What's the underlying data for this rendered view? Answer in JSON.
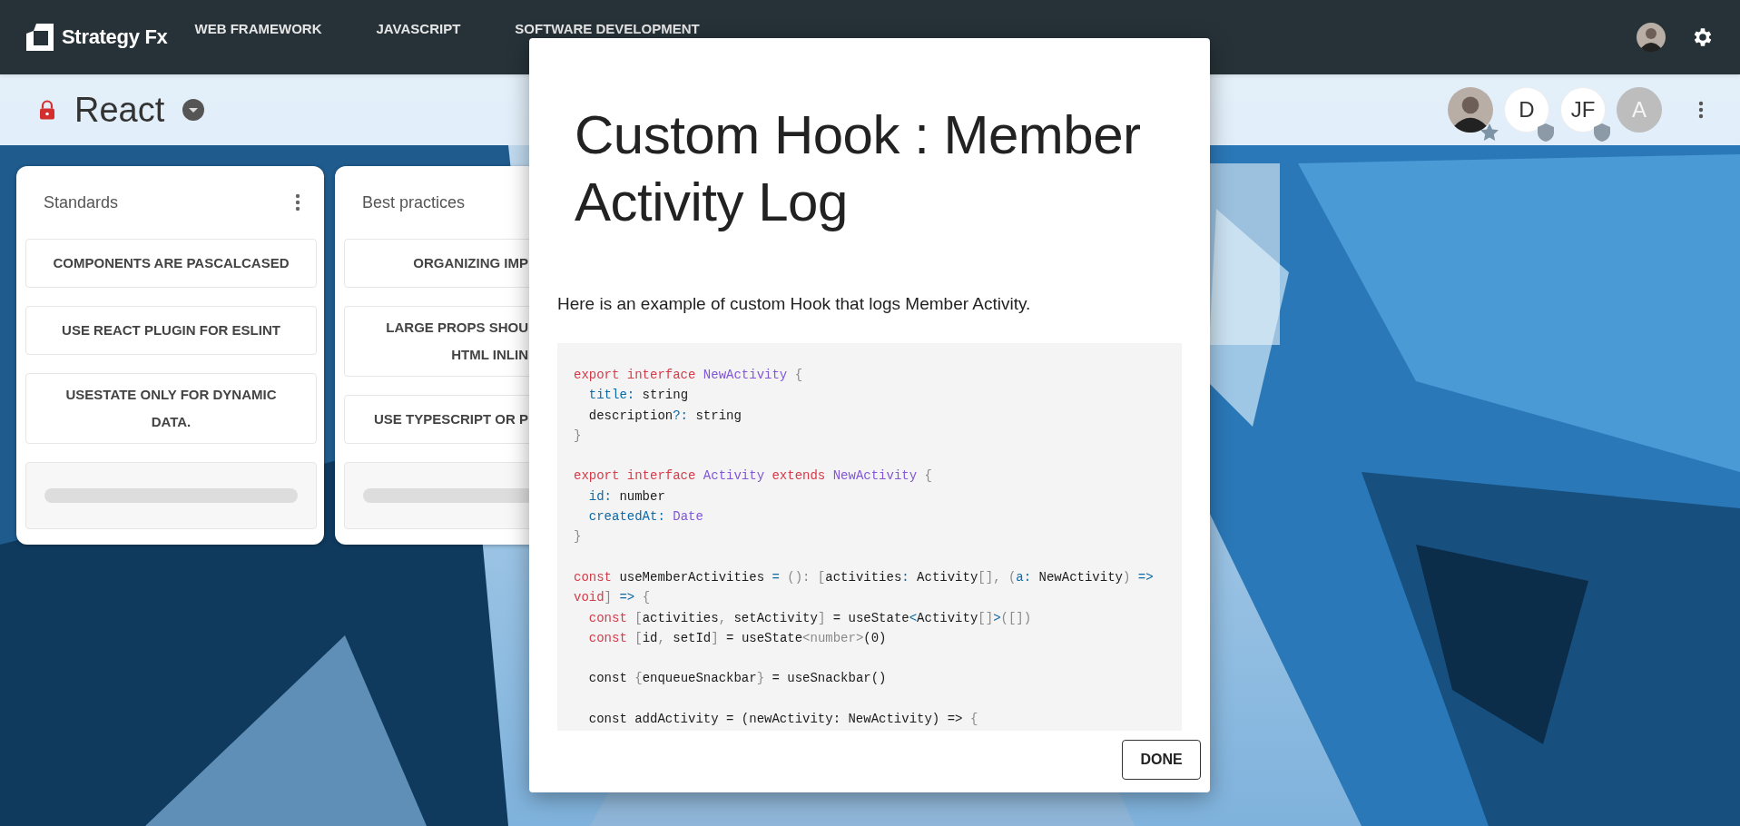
{
  "topbar": {
    "brand": "Strategy Fx",
    "nav": [
      {
        "label": "WEB FRAMEWORK"
      },
      {
        "label": "JAVASCRIPT"
      },
      {
        "label": "SOFTWARE DEVELOPMENT"
      }
    ]
  },
  "board": {
    "title": "React",
    "locked": true,
    "members": [
      {
        "badge": {
          "kind": "star"
        }
      },
      {
        "kind": "initials",
        "text": "D",
        "badge": {
          "kind": "shield"
        },
        "inactive": false
      },
      {
        "kind": "initials",
        "text": "JF",
        "badge": {
          "kind": "shield"
        },
        "inactive": false
      },
      {
        "kind": "initials",
        "text": "A",
        "inactive": true
      }
    ]
  },
  "lists": [
    {
      "title": "Standards",
      "cut": false,
      "cards": [
        "COMPONENTS ARE PASCALCASED",
        "USE REACT PLUGIN FOR ESLINT",
        "USESTATE ONLY FOR DYNAMIC DATA."
      ]
    },
    {
      "title": "Best practices",
      "cut": true,
      "cards": [
        "ORGANIZING IMP",
        "LARGE PROPS SHOU\nHTML INLIN",
        "USE TYPESCRIPT OR P"
      ]
    }
  ],
  "dialog": {
    "title": "Custom Hook : Member Activity Log",
    "text": "Here is an example of custom Hook that logs Member Activity.",
    "code": [
      {
        "kind": "code",
        "tokens": [
          {
            "kind": "kw",
            "text": "export interface "
          },
          {
            "kind": "type",
            "text": "NewActivity "
          },
          {
            "kind": "punct",
            "text": "{"
          }
        ]
      },
      {
        "kind": "code",
        "tokens": [
          {
            "kind": "prop",
            "text": "  title:"
          },
          {
            "kind": "plain",
            "text": " string"
          }
        ]
      },
      {
        "kind": "code",
        "tokens": [
          {
            "kind": "plain",
            "text": "  description"
          },
          {
            "kind": "prop",
            "text": "?:"
          },
          {
            "kind": "plain",
            "text": " string"
          }
        ]
      },
      {
        "kind": "code",
        "tokens": [
          {
            "kind": "punct",
            "text": "}"
          }
        ]
      },
      {
        "kind": "blank"
      },
      {
        "kind": "code",
        "tokens": [
          {
            "kind": "kw",
            "text": "export interface "
          },
          {
            "kind": "type",
            "text": "Activity "
          },
          {
            "kind": "kw",
            "text": "extends "
          },
          {
            "kind": "type",
            "text": "NewActivity "
          },
          {
            "kind": "punct",
            "text": "{"
          }
        ]
      },
      {
        "kind": "code",
        "tokens": [
          {
            "kind": "prop",
            "text": "  id:"
          },
          {
            "kind": "plain",
            "text": " number"
          }
        ]
      },
      {
        "kind": "code",
        "tokens": [
          {
            "kind": "prop",
            "text": "  createdAt:"
          },
          {
            "kind": "type",
            "text": " Date"
          }
        ]
      },
      {
        "kind": "code",
        "tokens": [
          {
            "kind": "punct",
            "text": "}"
          }
        ]
      },
      {
        "kind": "blank"
      },
      {
        "kind": "code",
        "tokens": [
          {
            "kind": "kw",
            "text": "const"
          },
          {
            "kind": "plain",
            "text": " useMemberActivities "
          },
          {
            "kind": "prop",
            "text": "="
          },
          {
            "kind": "punct",
            "text": " (): ["
          },
          {
            "kind": "plain",
            "text": "activities"
          },
          {
            "kind": "prop",
            "text": ":"
          },
          {
            "kind": "plain",
            "text": " Activity"
          },
          {
            "kind": "punct",
            "text": "[], ("
          },
          {
            "kind": "prop",
            "text": "a:"
          },
          {
            "kind": "plain",
            "text": " NewActivity"
          },
          {
            "kind": "punct",
            "text": ")"
          },
          {
            "kind": "prop",
            "text": " =>"
          }
        ]
      },
      {
        "kind": "code",
        "tokens": [
          {
            "kind": "kw",
            "text": "void"
          },
          {
            "kind": "punct",
            "text": "]"
          },
          {
            "kind": "prop",
            "text": " =>"
          },
          {
            "kind": "punct",
            "text": " {"
          }
        ]
      },
      {
        "kind": "code",
        "tokens": [
          {
            "kind": "kw",
            "text": "  const "
          },
          {
            "kind": "punct",
            "text": "["
          },
          {
            "kind": "plain",
            "text": "activities"
          },
          {
            "kind": "punct",
            "text": ","
          },
          {
            "kind": "plain",
            "text": " setActivity"
          },
          {
            "kind": "punct",
            "text": "]"
          },
          {
            "kind": "plain",
            "text": " = useState"
          },
          {
            "kind": "prop",
            "text": "<"
          },
          {
            "kind": "plain",
            "text": "Activity"
          },
          {
            "kind": "punct",
            "text": "[]"
          },
          {
            "kind": "prop",
            "text": ">"
          },
          {
            "kind": "punct",
            "text": "([])"
          }
        ]
      },
      {
        "kind": "code",
        "tokens": [
          {
            "kind": "kw",
            "text": "  const "
          },
          {
            "kind": "punct",
            "text": "["
          },
          {
            "kind": "plain",
            "text": "id"
          },
          {
            "kind": "punct",
            "text": ","
          },
          {
            "kind": "plain",
            "text": " setId"
          },
          {
            "kind": "punct",
            "text": "]"
          },
          {
            "kind": "plain",
            "text": " = useState"
          },
          {
            "kind": "punct",
            "text": "<number>"
          },
          {
            "kind": "plain",
            "text": "(0)"
          }
        ]
      },
      {
        "kind": "blank"
      },
      {
        "kind": "code",
        "tokens": [
          {
            "kind": "plain",
            "text": "  const "
          },
          {
            "kind": "punct",
            "text": "{"
          },
          {
            "kind": "plain",
            "text": "enqueueSnackbar"
          },
          {
            "kind": "punct",
            "text": "}"
          },
          {
            "kind": "plain",
            "text": " = useSnackbar()"
          }
        ]
      },
      {
        "kind": "blank"
      },
      {
        "kind": "code",
        "tokens": [
          {
            "kind": "plain",
            "text": "  const addActivity = (newActivity: NewActivity) => "
          },
          {
            "kind": "punct",
            "text": "{"
          }
        ]
      }
    ],
    "button": "DONE"
  }
}
